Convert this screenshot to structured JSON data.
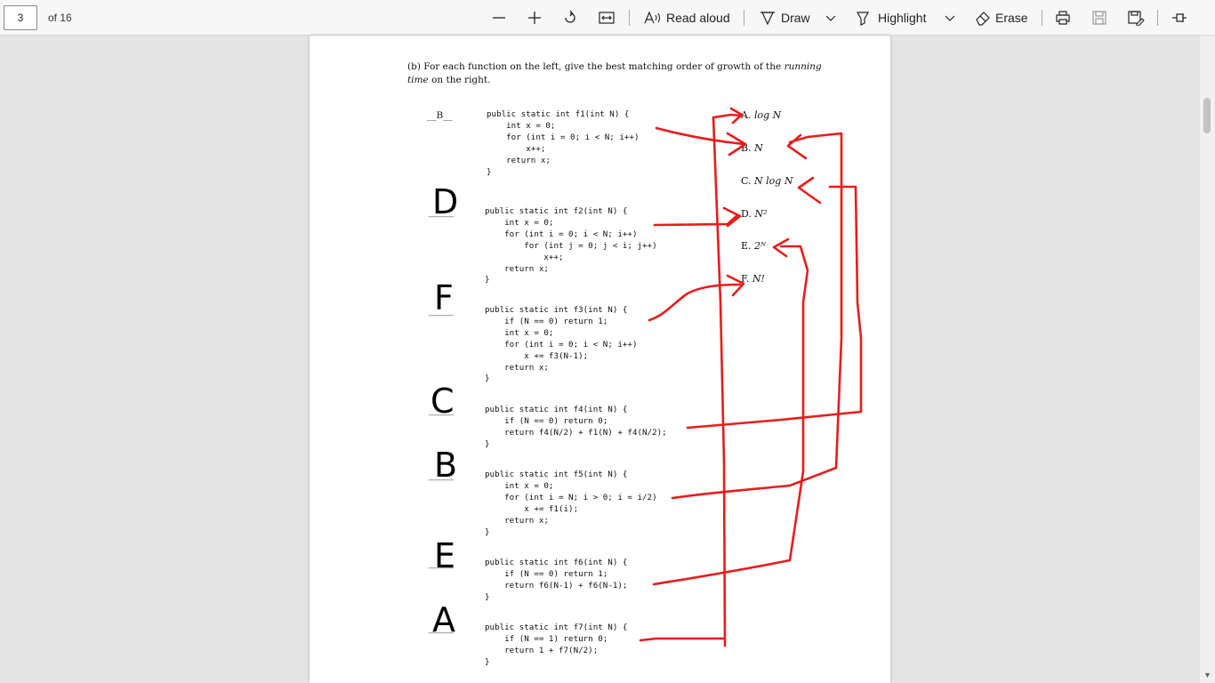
{
  "toolbar": {
    "page_number": "3",
    "page_count": "of 16",
    "zoom_out": "zoom-out",
    "zoom_in": "zoom-in",
    "read_aloud": "Read aloud",
    "draw": "Draw",
    "highlight": "Highlight",
    "erase": "Erase"
  },
  "document": {
    "question_label": "(b)",
    "question_text": "For each function on the left, give the best matching order of growth of the",
    "question_emph": "running time",
    "question_text2": "on the right.",
    "first_answer": "__B__",
    "functions": [
      "public static int f1(int N) {\n    int x = 0;\n    for (int i = 0; i < N; i++)\n        x++;\n    return x;\n}",
      "public static int f2(int N) {\n    int x = 0;\n    for (int i = 0; i < N; i++)\n        for (int j = 0; j < i; j++)\n            x++;\n    return x;\n}",
      "public static int f3(int N) {\n    if (N == 0) return 1;\n    int x = 0;\n    for (int i = 0; i < N; i++)\n        x += f3(N-1);\n    return x;\n}",
      "public static int f4(int N) {\n    if (N == 0) return 0;\n    return f4(N/2) + f1(N) + f4(N/2);\n}",
      "public static int f5(int N) {\n    int x = 0;\n    for (int i = N; i > 0; i = i/2)\n        x += f1(i);\n    return x;\n}",
      "public static int f6(int N) {\n    if (N == 0) return 1;\n    return f6(N-1) + f6(N-1);\n}",
      "public static int f7(int N) {\n    if (N == 1) return 0;\n    return 1 + f7(N/2);\n}"
    ],
    "options": [
      {
        "letter": "A.",
        "text": "log N"
      },
      {
        "letter": "B.",
        "text": "N"
      },
      {
        "letter": "C.",
        "text": "N log N"
      },
      {
        "letter": "D.",
        "text": "N²"
      },
      {
        "letter": "E.",
        "text": "2ᴺ"
      },
      {
        "letter": "F.",
        "text": "N!"
      }
    ],
    "handwritten_answers": [
      "D",
      "F",
      "C",
      "B",
      "E",
      "A"
    ],
    "ink_color": "#e81c1c"
  }
}
